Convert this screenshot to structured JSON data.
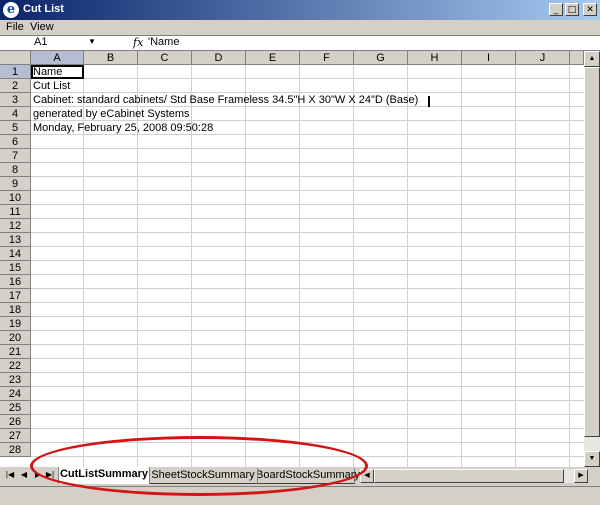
{
  "window": {
    "title": "Cut List",
    "app_icon_glyph": "e",
    "minimize_glyph": "_",
    "maximize_glyph": "□",
    "close_glyph": "✕"
  },
  "menu": {
    "items": [
      "File",
      "View"
    ]
  },
  "formula_bar": {
    "name_box": "A1",
    "dropdown_glyph": "▼",
    "fx_label": "fx",
    "formula": "'Name"
  },
  "columns": [
    "A",
    "B",
    "C",
    "D",
    "E",
    "F",
    "G",
    "H",
    "I",
    "J"
  ],
  "rows": [
    "1",
    "2",
    "3",
    "4",
    "5",
    "6",
    "7",
    "8",
    "9",
    "10",
    "11",
    "12",
    "13",
    "14",
    "15",
    "16",
    "17",
    "18",
    "19",
    "20",
    "21",
    "22",
    "23",
    "24",
    "25",
    "26",
    "27",
    "28"
  ],
  "cells": {
    "A1": "Name",
    "A2": "Cut List",
    "A3": "Cabinet: standard cabinets/ Std Base Frameless   34.5\"H X 30\"W X 24\"D  (Base)",
    "A4": "generated by eCabinet Systems",
    "A5": "Monday, February 25, 2008   09:50:28"
  },
  "sheet_tabs": {
    "nav": [
      "|◀",
      "◀",
      "▶",
      "▶|"
    ],
    "tabs": [
      "CutListSummary",
      "SheetStockSummary",
      "BoardStockSummary"
    ],
    "active": "CutListSummary"
  },
  "scroll_glyphs": {
    "up": "▲",
    "down": "▼",
    "left": "◀",
    "right": "▶"
  },
  "colors": {
    "title_start": "#0a246a",
    "title_end": "#a6caf0",
    "highlight_ellipse": "#d21414"
  }
}
